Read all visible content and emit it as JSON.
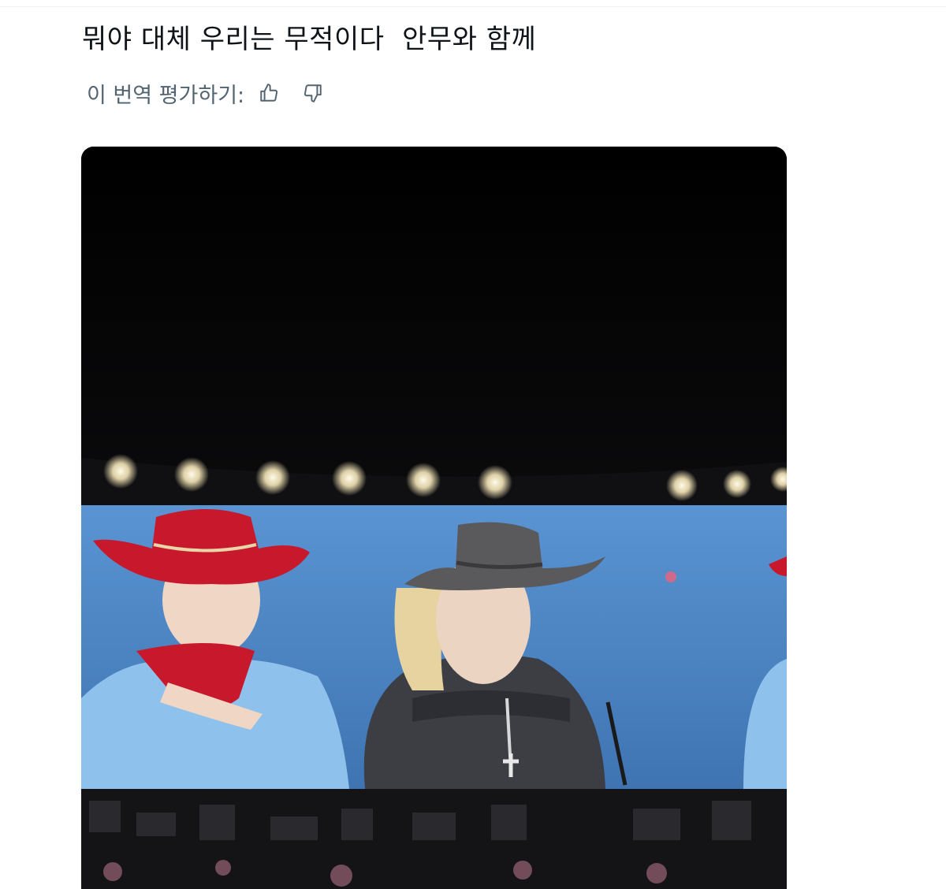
{
  "post": {
    "text": "뭐야 대체 우리는 무적이다  안무와 함께"
  },
  "translation_rating": {
    "label": "이 번역 평가하기:",
    "thumbs_up_icon": "thumbs-up-icon",
    "thumbs_down_icon": "thumbs-down-icon"
  },
  "media": {
    "kind": "video-still",
    "colors": {
      "sky": "#050505",
      "screen_blue": "#4d86c4",
      "red_hat": "#c8182c",
      "gray_hat": "#5a5a5c",
      "light_blue_shirt": "#8ec2ec",
      "dark_shirt": "#3c3e44"
    }
  }
}
